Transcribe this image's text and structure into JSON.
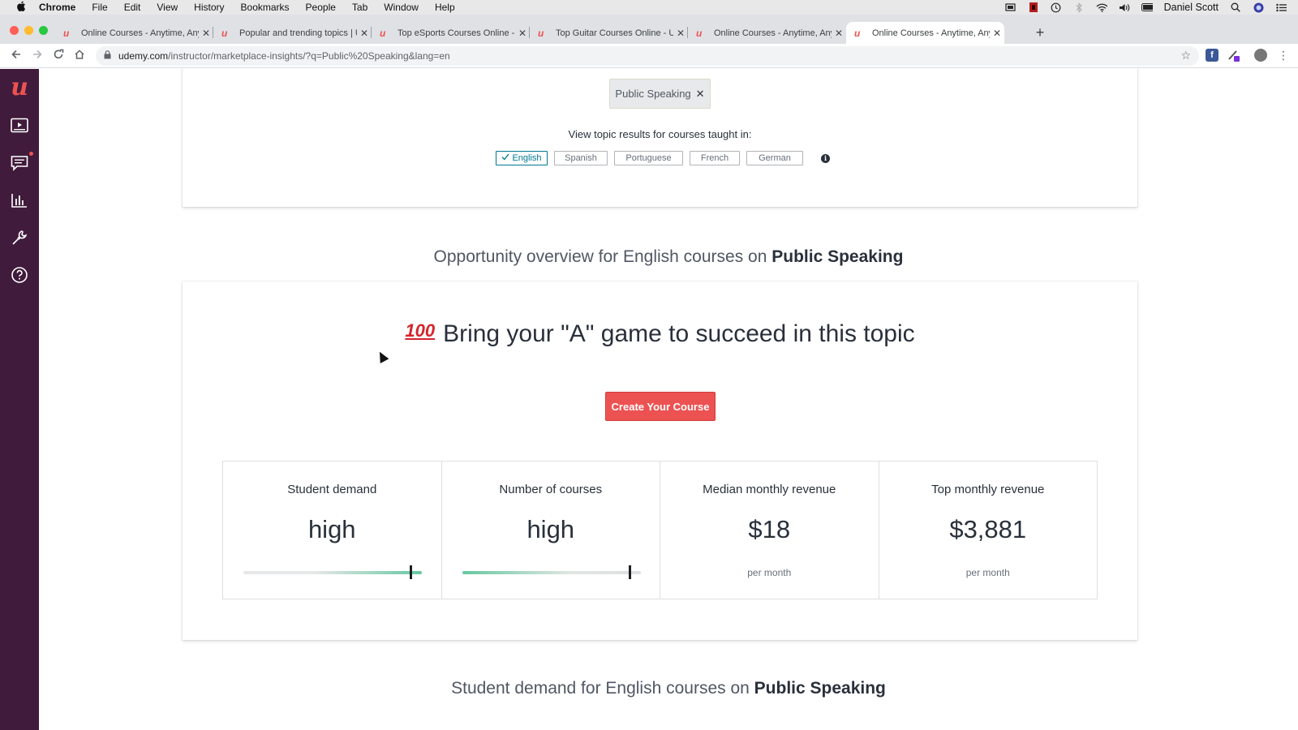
{
  "menubar": {
    "app": "Chrome",
    "items": [
      "File",
      "Edit",
      "View",
      "History",
      "Bookmarks",
      "People",
      "Tab",
      "Window",
      "Help"
    ],
    "user": "Daniel Scott"
  },
  "tabs": [
    {
      "title": "Online Courses - Anytime, Any",
      "active": false
    },
    {
      "title": "Popular and trending topics | U",
      "active": false
    },
    {
      "title": "Top eSports Courses Online - ",
      "active": false
    },
    {
      "title": "Top Guitar Courses Online - Up",
      "active": false
    },
    {
      "title": "Online Courses - Anytime, Any",
      "active": false
    },
    {
      "title": "Online Courses - Anytime, Any",
      "active": true
    }
  ],
  "address": {
    "host": "udemy.com",
    "path": "/instructor/marketplace-insights/?q=Public%20Speaking&lang=en"
  },
  "search": {
    "chip_label": "Public Speaking",
    "chip_close": "✕",
    "lang_hint": "View topic results for courses taught in:",
    "languages": [
      {
        "label": "English",
        "selected": true
      },
      {
        "label": "Spanish",
        "selected": false
      },
      {
        "label": "Portuguese",
        "selected": false
      },
      {
        "label": "French",
        "selected": false
      },
      {
        "label": "German",
        "selected": false
      }
    ]
  },
  "overview": {
    "title_prefix": "Opportunity overview for English courses on ",
    "title_topic": "Public Speaking",
    "emoji": "100",
    "headline": "Bring your \"A\" game to succeed in this topic",
    "cta_label": "Create Your Course",
    "metrics": [
      {
        "label": "Student demand",
        "value": "high",
        "gauge_level": 0.94
      },
      {
        "label": "Number of courses",
        "value": "high",
        "gauge_level": 0.94
      },
      {
        "label": "Median monthly revenue",
        "value": "$18",
        "sub": "per month"
      },
      {
        "label": "Top monthly revenue",
        "value": "$3,881",
        "sub": "per month"
      }
    ]
  },
  "demand_section": {
    "title_prefix": "Student demand for English courses on ",
    "title_topic": "Public Speaking"
  },
  "colors": {
    "brand_red": "#ec5252",
    "sidebar": "#401b3b",
    "accent_teal": "#007791",
    "gauge_green": "#66c8a0"
  }
}
